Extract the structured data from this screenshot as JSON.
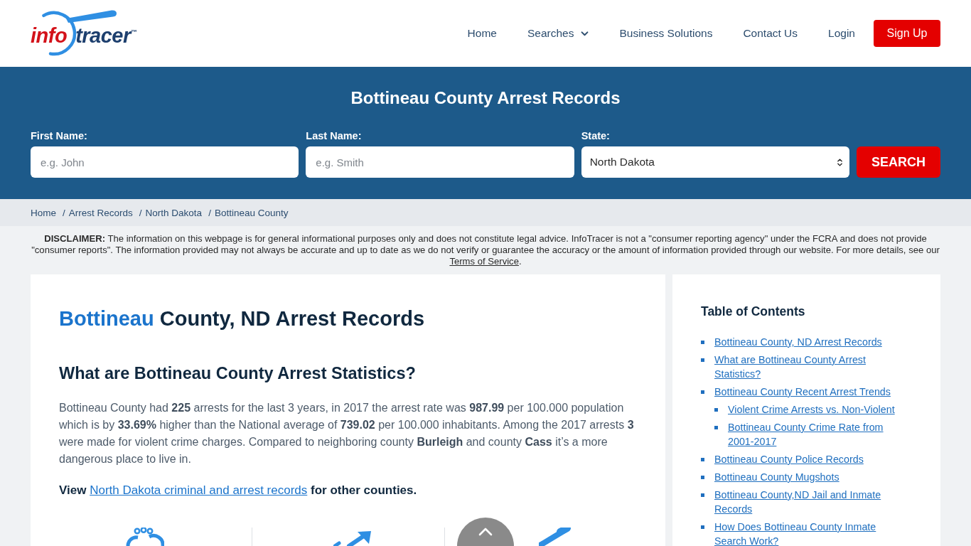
{
  "header": {
    "logo": {
      "part_1": "info",
      "part_2": "tracer",
      "trademark": "™"
    },
    "nav": [
      {
        "label": "Home",
        "kind": "link"
      },
      {
        "label": "Searches",
        "kind": "dropdown"
      },
      {
        "label": "Business Solutions",
        "kind": "link"
      },
      {
        "label": "Contact Us",
        "kind": "link"
      },
      {
        "label": "Login",
        "kind": "link"
      },
      {
        "label": "Sign Up",
        "kind": "button"
      }
    ]
  },
  "search_panel": {
    "title": "Bottineau County Arrest Records",
    "fields": [
      {
        "label": "First Name:",
        "kind": "text",
        "placeholder": "e.g. John"
      },
      {
        "label": "Last Name:",
        "kind": "text",
        "placeholder": "e.g. Smith"
      },
      {
        "label": "State:",
        "kind": "select",
        "value": "North Dakota"
      }
    ],
    "button": "SEARCH"
  },
  "breadcrumb": {
    "items": [
      {
        "label": "Home"
      },
      {
        "separator": "/",
        "label": "Arrest Records"
      },
      {
        "separator": "/",
        "label": "North Dakota"
      },
      {
        "separator": "/",
        "label": "Bottineau County"
      }
    ]
  },
  "disclaimer": {
    "text": "**DISCLAIMER:** The information on this webpage is for general informational purposes only and does not constitute legal advice. InfoTracer is not a \"consumer reporting agency\" under the FCRA and does not provide \"consumer reports\". The information provided may not always be accurate and up to date as we do not verify or guarantee the accuracy or the amount of information provided through our website. For more details, see our",
    "link": "Terms of Service",
    "after": "."
  },
  "article": {
    "title": {
      "highlight": "Bottineau",
      "rest": "County, ND Arrest Records"
    },
    "heading": "What are Bottineau County Arrest Statistics?",
    "paragraph": "Bottineau County had **225** arrests for the last 3 years, in 2017 the arrest rate was **987.99** per 100.000 population which is by **33.69%** higher than the National average of **739.02** per 100.000 inhabitants. Among the 2017 arrests **3** were made for violent crime charges. Compared to neighboring county **Burleigh** and county **Cass** it’s a more dangerous place to live in.",
    "view_line": {
      "before": "View",
      "link": "North Dakota criminal and arrest records",
      "after": "for other counties."
    }
  },
  "toc": {
    "title": "Table of Contents",
    "items": [
      {
        "label": "Bottineau County, ND Arrest Records"
      },
      {
        "label": "What are Bottineau County Arrest Statistics?"
      },
      {
        "label": "Bottineau County Recent Arrest Trends",
        "children": [
          {
            "label": "Violent Crime Arrests vs. Non-Violent"
          },
          {
            "label": "Bottineau County Crime Rate from 2001-2017"
          }
        ]
      },
      {
        "label": "Bottineau County Police Records"
      },
      {
        "label": "Bottineau County Mugshots"
      },
      {
        "label": "Bottineau County,ND Jail and Inmate Records"
      },
      {
        "label": "How Does Bottineau County Inmate Search Work?"
      }
    ]
  }
}
